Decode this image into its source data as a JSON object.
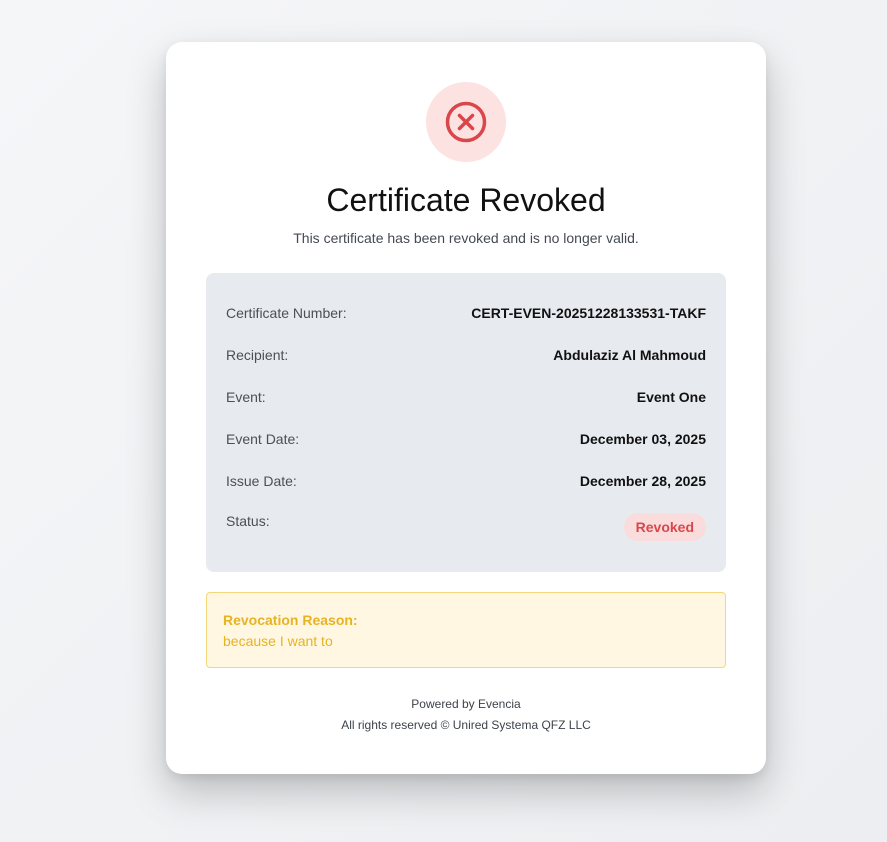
{
  "header": {
    "title": "Certificate Revoked",
    "subtitle": "This certificate has been revoked and is no longer valid.",
    "icon": "x-circle-icon"
  },
  "details": {
    "certificate_number_label": "Certificate Number:",
    "certificate_number_value": "CERT-EVEN-20251228133531-TAKF",
    "recipient_label": "Recipient:",
    "recipient_value": "Abdulaziz Al Mahmoud",
    "event_label": "Event:",
    "event_value": "Event One",
    "event_date_label": "Event Date:",
    "event_date_value": "December 03, 2025",
    "issue_date_label": "Issue Date:",
    "issue_date_value": "December 28, 2025",
    "status_label": "Status:",
    "status_value": "Revoked"
  },
  "revocation": {
    "title": "Revocation Reason:",
    "text": "because I want to"
  },
  "footer": {
    "powered_by": "Powered by Evencia",
    "rights": "All rights reserved © Unired Systema QFZ LLC"
  },
  "colors": {
    "danger": "#d9474b",
    "danger_bg": "#fde2e2",
    "warning": "#e6b323",
    "warning_bg": "#fff7e1"
  }
}
